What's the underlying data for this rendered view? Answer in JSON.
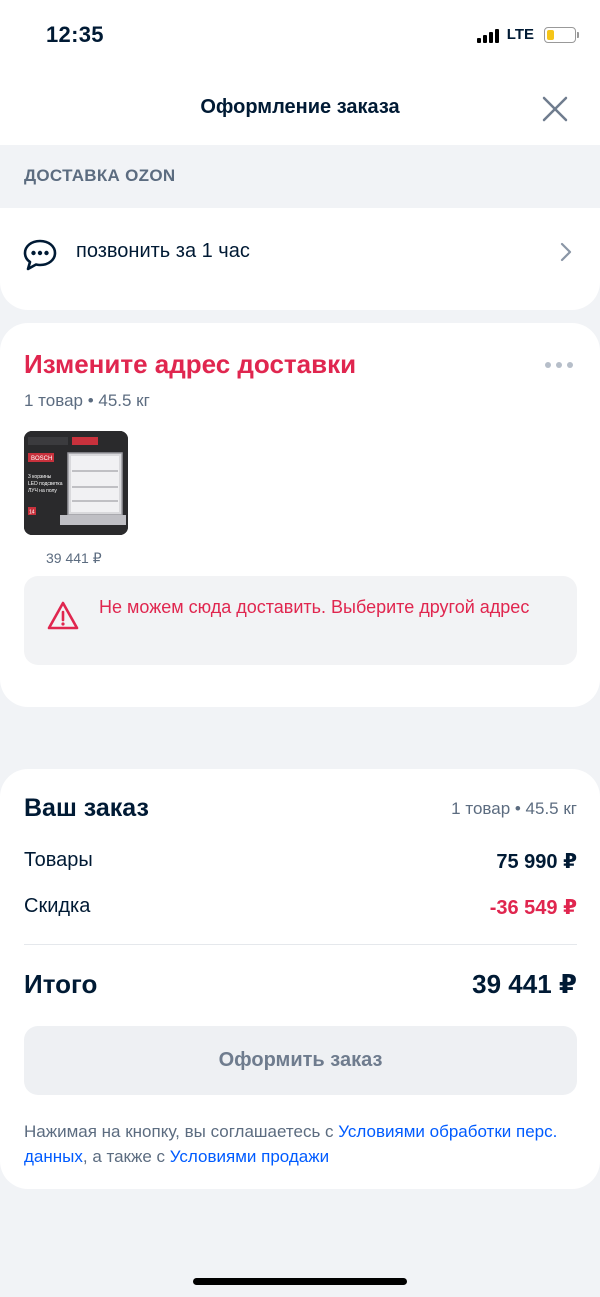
{
  "status_bar": {
    "time": "12:35",
    "network": "LTE"
  },
  "header": {
    "title": "Оформление заказа"
  },
  "delivery_section": {
    "label": "ДОСТАВКА OZON"
  },
  "call_option": {
    "label": "позвонить за 1 час"
  },
  "delivery_card": {
    "title": "Измените адрес доставки",
    "meta": "1 товар • 45.5 кг",
    "product_price": "39 441 ₽",
    "alert_text": "Не можем сюда доставить. Выберите другой адрес",
    "product_image": {
      "caption_line1": "3 корзины",
      "caption_line2": "LED подсветка",
      "caption_line3": "ЛУЧ на полу",
      "brand": "BOSCH",
      "badge": "14"
    }
  },
  "order_summary": {
    "title": "Ваш заказ",
    "meta": "1 товар • 45.5 кг",
    "goods_label": "Товары",
    "goods_value": "75 990 ₽",
    "discount_label": "Скидка",
    "discount_value": "-36 549 ₽",
    "total_label": "Итого",
    "total_value": "39 441 ₽",
    "submit_label": "Оформить заказ",
    "legal_prefix": "Нажимая на кнопку, вы соглашаетесь с ",
    "legal_link1": "Условиями обработки перс. данных",
    "legal_middle": ", а также с ",
    "legal_link2": "Условиями продажи"
  },
  "colors": {
    "accent_red": "#e0264f",
    "link_blue": "#005bff",
    "muted_text": "#5c6c80",
    "background": "#f1f3f6"
  },
  "icons": {
    "close": "close-icon",
    "call": "chat-bubble-icon",
    "chevron": "chevron-right-icon",
    "more": "more-dots-icon",
    "warning": "warning-triangle-icon"
  }
}
